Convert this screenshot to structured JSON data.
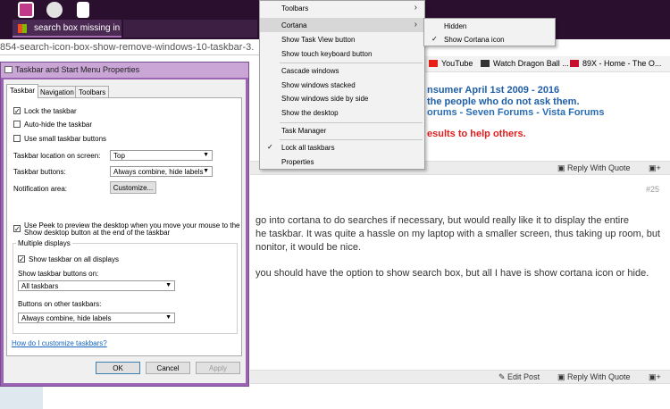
{
  "taskbar": {
    "task_label": "search box missing in task"
  },
  "browser": {
    "url_fragment": "854-search-icon-box-show-remove-windows-10-taskbar-3.",
    "bookmarks": [
      {
        "label": "YouTube",
        "color": "#e62117"
      },
      {
        "label": "Watch Dragon Ball ...",
        "color": "#333333"
      },
      {
        "label": "89X - Home - The O...",
        "color": "#c8102e"
      }
    ]
  },
  "forum": {
    "sig_line1": "nsumer April 1st 2009 - 2016",
    "sig_line2": "the people who do not ask them.",
    "sig_line3": "orums - Seven Forums - Vista Forums",
    "sig_line4": "esults to help others.",
    "reply_with_quote": "Reply With Quote",
    "edit_post": "Edit Post",
    "post_number": "#25",
    "body_line1": "go into cortana to do searches if necessary, but would really like it to display the entire",
    "body_line2": "he taskbar. It was quite a hassle on my laptop with a smaller screen, thus taking up room, but",
    "body_line3": "nonitor, it would be nice.",
    "body_line4": "you should have the option to show search box, but all I have is show cortana icon or hide."
  },
  "dialog": {
    "title": "Taskbar and Start Menu Properties",
    "tabs": [
      "Taskbar",
      "Navigation",
      "Toolbars"
    ],
    "lock_taskbar": "Lock the taskbar",
    "auto_hide": "Auto-hide the taskbar",
    "small_buttons": "Use small taskbar buttons",
    "location_label": "Taskbar location on screen:",
    "location_value": "Top",
    "buttons_label": "Taskbar buttons:",
    "buttons_value": "Always combine, hide labels",
    "notification_label": "Notification area:",
    "customize_button": "Customize...",
    "peek_line1": "Use Peek to preview the desktop when you move your mouse to the",
    "peek_line2": "Show desktop button at the end of the taskbar",
    "multiple_displays": "Multiple displays",
    "show_all_displays": "Show taskbar on all displays",
    "show_buttons_on_label": "Show taskbar buttons on:",
    "show_buttons_on_value": "All taskbars",
    "other_buttons_label": "Buttons on other taskbars:",
    "other_buttons_value": "Always combine, hide labels",
    "help_link": "How do I customize taskbars?",
    "ok": "OK",
    "cancel": "Cancel",
    "apply": "Apply"
  },
  "context_menu": {
    "items": [
      "Toolbars",
      "Cortana",
      "Show Task View button",
      "Show touch keyboard button",
      "Cascade windows",
      "Show windows stacked",
      "Show windows side by side",
      "Show the desktop",
      "Task Manager",
      "Lock all taskbars",
      "Properties"
    ],
    "submenu": [
      "Hidden",
      "Show Cortana icon"
    ],
    "checkmark": "✓",
    "chevron": "›"
  }
}
